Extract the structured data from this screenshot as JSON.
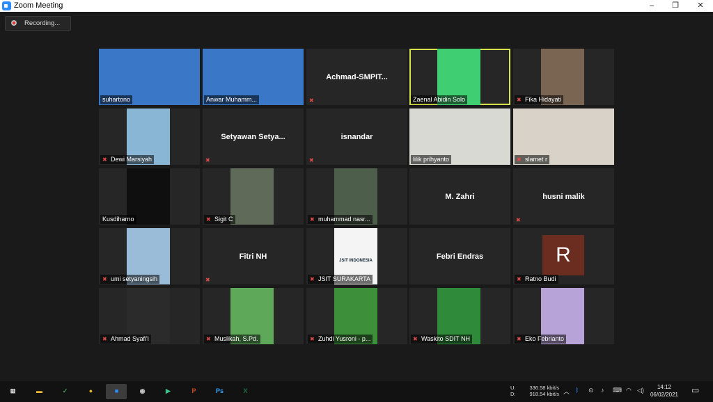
{
  "window": {
    "title": "Zoom Meeting",
    "minimize": "–",
    "restore": "❐",
    "close": "✕"
  },
  "recording": {
    "label": "Recording..."
  },
  "participants": [
    {
      "name": "suhartono",
      "type": "video",
      "bg": "#3a77c7",
      "muted": false
    },
    {
      "name": "Anwar Muhamm...",
      "type": "video",
      "bg": "#3a77c7",
      "muted": false
    },
    {
      "name": "Achmad-SMPIT...",
      "type": "name",
      "muted": true
    },
    {
      "name": "Zaenal Abidin Solo",
      "type": "video",
      "bg": "#3fcf72",
      "muted": false,
      "active": true
    },
    {
      "name": "Fika Hidayati",
      "type": "video",
      "bg": "#7a6552",
      "muted": true
    },
    {
      "name": "Dewi Marsiyah",
      "type": "video",
      "bg": "#8ab6d6",
      "muted": true
    },
    {
      "name": "Setyawan  Setya...",
      "type": "name",
      "muted": true
    },
    {
      "name": "isnandar",
      "type": "name",
      "muted": true
    },
    {
      "name": "lilik prihyanto",
      "type": "video",
      "bg": "#d9d9d4",
      "muted": false
    },
    {
      "name": "slamet r",
      "type": "video",
      "bg": "#d8d2c8",
      "muted": true
    },
    {
      "name": "Kusdiharno",
      "type": "video",
      "bg": "#0f0f0f",
      "muted": false
    },
    {
      "name": "Sigit C",
      "type": "video",
      "bg": "#5f6b58",
      "muted": true
    },
    {
      "name": "muhammad nasr...",
      "type": "video",
      "bg": "#4d5e4a",
      "muted": true
    },
    {
      "name": "M. Zahri",
      "type": "name",
      "muted": false
    },
    {
      "name": "husni malik",
      "type": "name",
      "muted": true
    },
    {
      "name": "umi setyaningsih",
      "type": "video",
      "bg": "#9bbcd9",
      "muted": true
    },
    {
      "name": "Fitri NH",
      "type": "name",
      "muted": true
    },
    {
      "name": "JSIT SURAKARTA",
      "type": "video",
      "bg": "#f4f4f4",
      "muted": true,
      "logo": "JSIT INDONESIA"
    },
    {
      "name": "Febri Endras",
      "type": "name",
      "muted": false
    },
    {
      "name": "Ratno Budi",
      "type": "avatar",
      "initial": "R",
      "muted": true
    },
    {
      "name": "Ahmad Syafi'i",
      "type": "video",
      "bg": "#2b2b2b",
      "muted": true
    },
    {
      "name": "Muslikah, S.Pd.",
      "type": "video",
      "bg": "#5ea85a",
      "muted": true
    },
    {
      "name": "Zuhdi Yusroni - p...",
      "type": "video",
      "bg": "#3e8f3a",
      "muted": true
    },
    {
      "name": "Waskito SDIT NH",
      "type": "video",
      "bg": "#2f8a3a",
      "muted": true
    },
    {
      "name": "Eko Febrianto",
      "type": "video",
      "bg": "#b7a3d8",
      "muted": true
    }
  ],
  "taskbar": {
    "apps": [
      {
        "icon": "windows-start-icon",
        "glyph": "⊞",
        "color": "#ffffff"
      },
      {
        "icon": "file-explorer-icon",
        "glyph": "▬",
        "color": "#e9b437"
      },
      {
        "icon": "app-green-icon",
        "glyph": "✓",
        "color": "#4aa05a"
      },
      {
        "icon": "chrome-icon",
        "glyph": "●",
        "color": "#e0b52c"
      },
      {
        "icon": "zoom-icon",
        "glyph": "■",
        "color": "#2d8cff"
      },
      {
        "icon": "obs-icon",
        "glyph": "◉",
        "color": "#c8c8c8"
      },
      {
        "icon": "app-arrow-icon",
        "glyph": "▶",
        "color": "#3dbf8a"
      },
      {
        "icon": "powerpoint-icon",
        "glyph": "P",
        "color": "#d24726"
      },
      {
        "icon": "photoshop-icon",
        "glyph": "Ps",
        "color": "#31a8ff"
      },
      {
        "icon": "excel-icon",
        "glyph": "X",
        "color": "#1e7145"
      }
    ],
    "upload": "336.58 kbit/s",
    "download": "918.54 kbit/s",
    "u_label": "U:",
    "d_label": "D:",
    "time": "14:12",
    "date": "06/02/2021"
  }
}
